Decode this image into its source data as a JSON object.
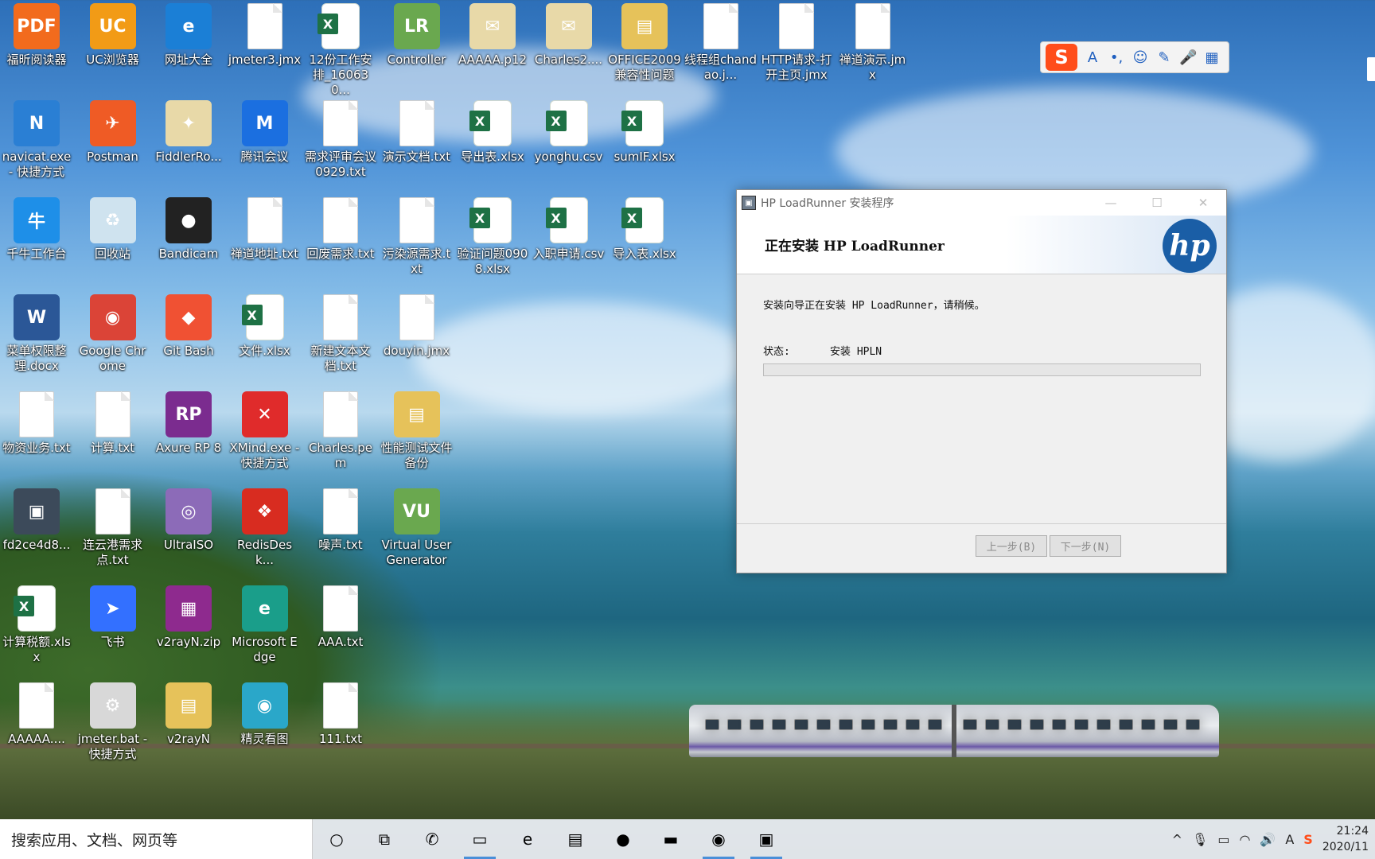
{
  "desktop": {
    "icons": [
      {
        "label": "福昕阅读器",
        "icon": "foxit-pdf-icon",
        "kind": "app",
        "color": "#f26b1d",
        "text": "PDF"
      },
      {
        "label": "UC浏览器",
        "icon": "uc-browser-icon",
        "kind": "app",
        "color": "#f29b16",
        "text": "UC"
      },
      {
        "label": "网址大全",
        "icon": "ie-browser-icon",
        "kind": "app",
        "color": "#1b7fd6",
        "text": "e"
      },
      {
        "label": "jmeter3.jmx",
        "icon": "file-icon",
        "kind": "doc"
      },
      {
        "label": "12份工作安排_160630...",
        "icon": "excel-file-icon",
        "kind": "xls"
      },
      {
        "label": "Controller",
        "icon": "loadrunner-controller-icon",
        "kind": "app",
        "color": "#6aa84f",
        "text": "LR"
      },
      {
        "label": "AAAAA.p12",
        "icon": "certificate-icon",
        "kind": "app",
        "color": "#e8d9a8",
        "text": "✉"
      },
      {
        "label": "Charles2....",
        "icon": "certificate-icon",
        "kind": "app",
        "color": "#e8d9a8",
        "text": "✉"
      },
      {
        "label": "OFFICE2009兼容性问题",
        "icon": "folder-icon",
        "kind": "app",
        "color": "#e6c25a",
        "text": "▤"
      },
      {
        "label": "线程组chandao.j...",
        "icon": "file-icon",
        "kind": "doc"
      },
      {
        "label": "HTTP请求-打开主页.jmx",
        "icon": "file-icon",
        "kind": "doc"
      },
      {
        "label": "禅道演示.jmx",
        "icon": "file-icon",
        "kind": "doc"
      },
      {
        "label": "navicat.exe - 快捷方式",
        "icon": "navicat-icon",
        "kind": "app",
        "color": "#2a7fd4",
        "text": "N"
      },
      {
        "label": "Postman",
        "icon": "postman-icon",
        "kind": "app",
        "color": "#ef5b25",
        "text": "✈"
      },
      {
        "label": "FiddlerRo...",
        "icon": "certificate-icon",
        "kind": "app",
        "color": "#e8d9a8",
        "text": "✦"
      },
      {
        "label": "腾讯会议",
        "icon": "tencent-meeting-icon",
        "kind": "app",
        "color": "#1b6fe0",
        "text": "M"
      },
      {
        "label": "需求评审会议0929.txt",
        "icon": "file-icon",
        "kind": "doc"
      },
      {
        "label": "演示文档.txt",
        "icon": "file-icon",
        "kind": "doc"
      },
      {
        "label": "导出表.xlsx",
        "icon": "excel-file-icon",
        "kind": "xls"
      },
      {
        "label": "yonghu.csv",
        "icon": "excel-file-icon",
        "kind": "xls"
      },
      {
        "label": "sumIF.xlsx",
        "icon": "excel-file-icon",
        "kind": "xls"
      },
      {
        "label": "千牛工作台",
        "icon": "qianniu-icon",
        "kind": "app",
        "color": "#1e8fe8",
        "text": "牛"
      },
      {
        "label": "回收站",
        "icon": "recycle-bin-icon",
        "kind": "app",
        "color": "#cfe3ef",
        "text": "♻"
      },
      {
        "label": "Bandicam",
        "icon": "bandicam-icon",
        "kind": "app",
        "color": "#222222",
        "text": "●"
      },
      {
        "label": "禅道地址.txt",
        "icon": "file-icon",
        "kind": "doc"
      },
      {
        "label": "回废需求.txt",
        "icon": "file-icon",
        "kind": "doc"
      },
      {
        "label": "污染源需求.txt",
        "icon": "file-icon",
        "kind": "doc"
      },
      {
        "label": "验证问题0908.xlsx",
        "icon": "excel-file-icon",
        "kind": "xls"
      },
      {
        "label": "入职申请.csv",
        "icon": "excel-file-icon",
        "kind": "xls"
      },
      {
        "label": "导入表.xlsx",
        "icon": "excel-file-icon",
        "kind": "xls"
      },
      {
        "label": "菜单权限整理.docx",
        "icon": "word-file-icon",
        "kind": "app",
        "color": "#2b5797",
        "text": "W"
      },
      {
        "label": "Google Chrome",
        "icon": "chrome-icon",
        "kind": "app",
        "color": "#db4437",
        "text": "◉"
      },
      {
        "label": "Git Bash",
        "icon": "git-bash-icon",
        "kind": "app",
        "color": "#f05133",
        "text": "◆"
      },
      {
        "label": "文件.xlsx",
        "icon": "excel-file-icon",
        "kind": "xls"
      },
      {
        "label": "新建文本文档.txt",
        "icon": "file-icon",
        "kind": "doc"
      },
      {
        "label": "douyin.jmx",
        "icon": "file-icon",
        "kind": "doc"
      },
      {
        "label": "物资业务.txt",
        "icon": "file-icon",
        "kind": "doc"
      },
      {
        "label": "计算.txt",
        "icon": "file-icon",
        "kind": "doc"
      },
      {
        "label": "Axure RP 8",
        "icon": "axure-icon",
        "kind": "app",
        "color": "#7b2c8f",
        "text": "RP"
      },
      {
        "label": "XMind.exe - 快捷方式",
        "icon": "xmind-icon",
        "kind": "app",
        "color": "#e02b2b",
        "text": "✕"
      },
      {
        "label": "Charles.pem",
        "icon": "file-icon",
        "kind": "doc"
      },
      {
        "label": "性能测试文件备份",
        "icon": "folder-icon",
        "kind": "app",
        "color": "#e6c25a",
        "text": "▤"
      },
      {
        "label": "fd2ce4d8...",
        "icon": "image-file-icon",
        "kind": "app",
        "color": "#3c4a5a",
        "text": "▣"
      },
      {
        "label": "连云港需求点.txt",
        "icon": "file-icon",
        "kind": "doc"
      },
      {
        "label": "UltraISO",
        "icon": "ultraiso-icon",
        "kind": "app",
        "color": "#8c6bb8",
        "text": "◎"
      },
      {
        "label": "RedisDesk...",
        "icon": "redis-icon",
        "kind": "app",
        "color": "#d82c20",
        "text": "❖"
      },
      {
        "label": "噪声.txt",
        "icon": "file-icon",
        "kind": "doc"
      },
      {
        "label": "Virtual User Generator",
        "icon": "loadrunner-vugen-icon",
        "kind": "app",
        "color": "#6aa84f",
        "text": "VU"
      },
      {
        "label": "计算税额.xlsx",
        "icon": "excel-file-icon",
        "kind": "xls"
      },
      {
        "label": "飞书",
        "icon": "feishu-icon",
        "kind": "app",
        "color": "#3370ff",
        "text": "➤"
      },
      {
        "label": "v2rayN.zip",
        "icon": "winrar-icon",
        "kind": "app",
        "color": "#8e2a8e",
        "text": "▦"
      },
      {
        "label": "Microsoft Edge",
        "icon": "edge-icon",
        "kind": "app",
        "color": "#1a9e8a",
        "text": "e"
      },
      {
        "label": "AAA.txt",
        "icon": "file-icon",
        "kind": "doc"
      },
      {
        "label": "AAAAA....",
        "icon": "file-icon",
        "kind": "doc"
      },
      {
        "label": "jmeter.bat - 快捷方式",
        "icon": "gear-file-icon",
        "kind": "app",
        "color": "#d8d8d8",
        "text": "⚙"
      },
      {
        "label": "v2rayN",
        "icon": "folder-icon",
        "kind": "app",
        "color": "#e6c25a",
        "text": "▤"
      },
      {
        "label": "精灵看图",
        "icon": "image-viewer-icon",
        "kind": "app",
        "color": "#2aa7c9",
        "text": "◉"
      },
      {
        "label": "111.txt",
        "icon": "file-icon",
        "kind": "doc"
      }
    ]
  },
  "ime_toolbar": {
    "logo": "S",
    "buttons": [
      "A",
      "•,",
      "☺",
      "✎",
      "🎤",
      "▦"
    ]
  },
  "installer": {
    "window_title": "HP LoadRunner 安装程序",
    "minimize": "—",
    "maximize": "☐",
    "close": "✕",
    "heading": "正在安装 HP LoadRunner",
    "logo_text": "hp",
    "description": "安装向导正在安装 HP LoadRunner，请稍候。",
    "status_label": "状态:",
    "status_value": "安装 HPLN",
    "progress_fraction": 0.0,
    "back_button": "上一步(B)",
    "next_button": "下一步(N)"
  },
  "taskbar": {
    "search_placeholder": "搜索应用、文档、网页等",
    "apps": [
      {
        "name": "cortana-icon",
        "glyph": "○",
        "active": false
      },
      {
        "name": "task-view-icon",
        "glyph": "⧉",
        "active": false
      },
      {
        "name": "wechat-icon",
        "glyph": "✆",
        "active": false
      },
      {
        "name": "notebook-icon",
        "glyph": "▭",
        "active": true
      },
      {
        "name": "ie-icon",
        "glyph": "e",
        "active": false
      },
      {
        "name": "file-explorer-icon",
        "glyph": "▤",
        "active": false
      },
      {
        "name": "bandicam-icon",
        "glyph": "●",
        "active": false
      },
      {
        "name": "terminal-icon",
        "glyph": "▬",
        "active": false
      },
      {
        "name": "chrome-icon",
        "glyph": "◉",
        "active": true
      },
      {
        "name": "installer-icon",
        "glyph": "▣",
        "active": true
      }
    ],
    "tray": {
      "chevron": "^",
      "mic": "🎙",
      "battery": "▭",
      "wifi": "◠",
      "volume": "🔊",
      "ime": "A",
      "sogou": "S",
      "time": "21:24",
      "date": "2020/11"
    }
  }
}
